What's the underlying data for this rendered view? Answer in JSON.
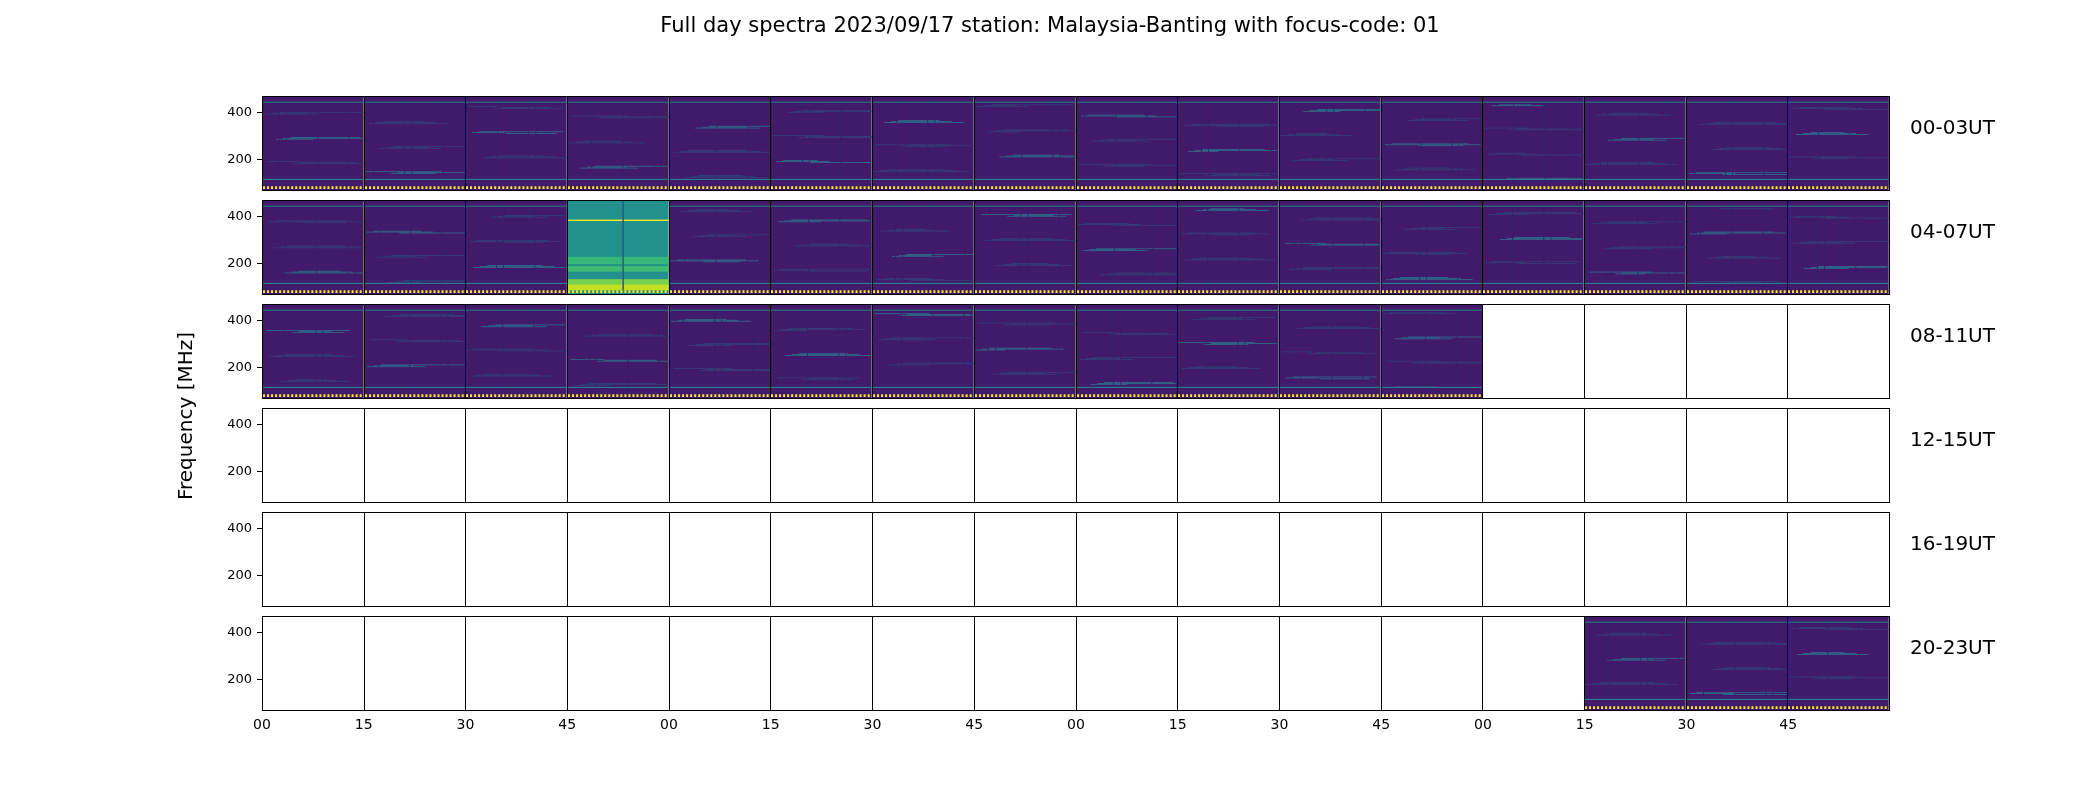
{
  "title": "Full day spectra 2023/09/17 station: Malaysia-Banting with focus-code: 01",
  "ylabel": "Frequency [MHz]",
  "xticks": [
    "00",
    "15",
    "30",
    "45",
    "00",
    "15",
    "30",
    "45",
    "00",
    "15",
    "30",
    "45",
    "00",
    "15",
    "30",
    "45"
  ],
  "rows": [
    {
      "label": "00-03UT",
      "yticks": [
        "400",
        "200"
      ],
      "cells": [
        {
          "kind": "spectrum"
        },
        {
          "kind": "spectrum"
        },
        {
          "kind": "spectrum"
        },
        {
          "kind": "spectrum"
        },
        {
          "kind": "spectrum"
        },
        {
          "kind": "spectrum"
        },
        {
          "kind": "spectrum"
        },
        {
          "kind": "spectrum"
        },
        {
          "kind": "spectrum"
        },
        {
          "kind": "spectrum"
        },
        {
          "kind": "spectrum"
        },
        {
          "kind": "spectrum"
        },
        {
          "kind": "spectrum"
        },
        {
          "kind": "spectrum"
        },
        {
          "kind": "spectrum"
        },
        {
          "kind": "spectrum"
        }
      ]
    },
    {
      "label": "04-07UT",
      "yticks": [
        "400",
        "200"
      ],
      "cells": [
        {
          "kind": "spectrum"
        },
        {
          "kind": "spectrum"
        },
        {
          "kind": "spectrum"
        },
        {
          "kind": "bright"
        },
        {
          "kind": "spectrum"
        },
        {
          "kind": "spectrum"
        },
        {
          "kind": "spectrum"
        },
        {
          "kind": "spectrum"
        },
        {
          "kind": "spectrum"
        },
        {
          "kind": "spectrum"
        },
        {
          "kind": "spectrum"
        },
        {
          "kind": "spectrum"
        },
        {
          "kind": "spectrum"
        },
        {
          "kind": "spectrum"
        },
        {
          "kind": "spectrum"
        },
        {
          "kind": "spectrum"
        }
      ]
    },
    {
      "label": "08-11UT",
      "yticks": [
        "400",
        "200"
      ],
      "cells": [
        {
          "kind": "spectrum"
        },
        {
          "kind": "spectrum"
        },
        {
          "kind": "spectrum"
        },
        {
          "kind": "spectrum"
        },
        {
          "kind": "spectrum"
        },
        {
          "kind": "spectrum"
        },
        {
          "kind": "spectrum"
        },
        {
          "kind": "spectrum"
        },
        {
          "kind": "spectrum"
        },
        {
          "kind": "spectrum"
        },
        {
          "kind": "spectrum"
        },
        {
          "kind": "spectrum"
        },
        {
          "kind": "empty"
        },
        {
          "kind": "empty"
        },
        {
          "kind": "empty"
        },
        {
          "kind": "empty"
        }
      ]
    },
    {
      "label": "12-15UT",
      "yticks": [
        "400",
        "200"
      ],
      "cells": [
        {
          "kind": "empty"
        },
        {
          "kind": "empty"
        },
        {
          "kind": "empty"
        },
        {
          "kind": "empty"
        },
        {
          "kind": "empty"
        },
        {
          "kind": "empty"
        },
        {
          "kind": "empty"
        },
        {
          "kind": "empty"
        },
        {
          "kind": "empty"
        },
        {
          "kind": "empty"
        },
        {
          "kind": "empty"
        },
        {
          "kind": "empty"
        },
        {
          "kind": "empty"
        },
        {
          "kind": "empty"
        },
        {
          "kind": "empty"
        },
        {
          "kind": "empty"
        }
      ]
    },
    {
      "label": "16-19UT",
      "yticks": [
        "400",
        "200"
      ],
      "cells": [
        {
          "kind": "empty"
        },
        {
          "kind": "empty"
        },
        {
          "kind": "empty"
        },
        {
          "kind": "empty"
        },
        {
          "kind": "empty"
        },
        {
          "kind": "empty"
        },
        {
          "kind": "empty"
        },
        {
          "kind": "empty"
        },
        {
          "kind": "empty"
        },
        {
          "kind": "empty"
        },
        {
          "kind": "empty"
        },
        {
          "kind": "empty"
        },
        {
          "kind": "empty"
        },
        {
          "kind": "empty"
        },
        {
          "kind": "empty"
        },
        {
          "kind": "empty"
        }
      ]
    },
    {
      "label": "20-23UT",
      "yticks": [
        "400",
        "200"
      ],
      "cells": [
        {
          "kind": "empty"
        },
        {
          "kind": "empty"
        },
        {
          "kind": "empty"
        },
        {
          "kind": "empty"
        },
        {
          "kind": "empty"
        },
        {
          "kind": "empty"
        },
        {
          "kind": "empty"
        },
        {
          "kind": "empty"
        },
        {
          "kind": "empty"
        },
        {
          "kind": "empty"
        },
        {
          "kind": "empty"
        },
        {
          "kind": "empty"
        },
        {
          "kind": "empty"
        },
        {
          "kind": "spectrum"
        },
        {
          "kind": "spectrum"
        },
        {
          "kind": "spectrum"
        }
      ]
    }
  ]
}
